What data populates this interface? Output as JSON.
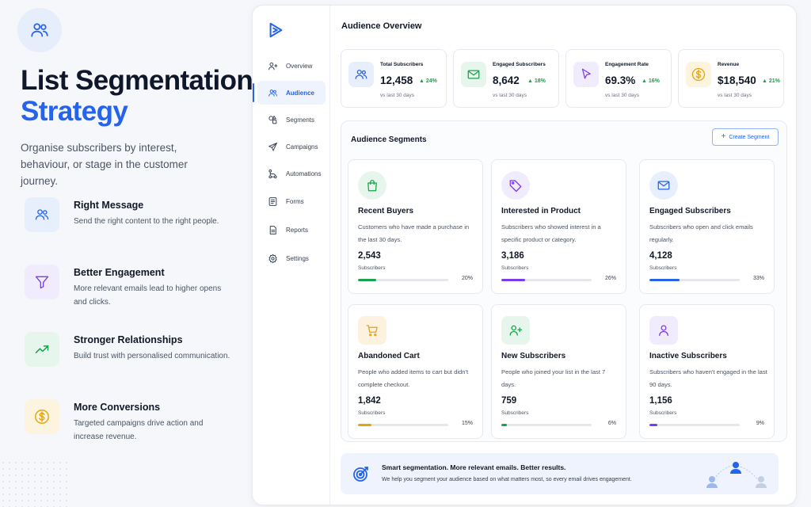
{
  "hero": {
    "title_line1": "List Segmentation",
    "title_line2": "Strategy",
    "subtitle": "Organise subscribers by interest, behaviour, or stage in the customer journey.",
    "features": [
      {
        "icon": "users-icon",
        "title": "Right Message",
        "desc": "Send the right content to the right people.",
        "color": "#2563eb",
        "bg": "#e8effc"
      },
      {
        "icon": "filter-icon",
        "title": "Better Engagement",
        "desc": "More relevant emails lead to higher opens and clicks.",
        "color": "#7c3aed",
        "bg": "#f1ecfd"
      },
      {
        "icon": "trend-up-icon",
        "title": "Stronger Relationships",
        "desc": "Build trust with personalised communication.",
        "color": "#16a34a",
        "bg": "#e7f6ec"
      },
      {
        "icon": "dollar-icon",
        "title": "More Conversions",
        "desc": "Targeted campaigns drive action and increase revenue.",
        "color": "#e5a50a",
        "bg": "#fdf4e0"
      }
    ]
  },
  "sidebar": {
    "items": [
      {
        "label": "Overview",
        "icon": "user-plus-icon",
        "active": false
      },
      {
        "label": "Audience",
        "icon": "users-icon",
        "active": true
      },
      {
        "label": "Segments",
        "icon": "shapes-icon",
        "active": false
      },
      {
        "label": "Campaigns",
        "icon": "send-icon",
        "active": false
      },
      {
        "label": "Automations",
        "icon": "workflow-icon",
        "active": false
      },
      {
        "label": "Forms",
        "icon": "form-icon",
        "active": false
      },
      {
        "label": "Reports",
        "icon": "report-icon",
        "active": false
      },
      {
        "label": "Settings",
        "icon": "gear-icon",
        "active": false
      }
    ]
  },
  "main": {
    "title": "Audience Overview",
    "stats": [
      {
        "label": "Total Subscribers",
        "value": "12,458",
        "change": "24%",
        "period": "vs last 30 days",
        "icon": "users-icon",
        "color": "#2563eb",
        "bg": "#e8effc"
      },
      {
        "label": "Engaged Subscribers",
        "value": "8,642",
        "change": "18%",
        "period": "vs last 30 days",
        "icon": "mail-icon",
        "color": "#16a34a",
        "bg": "#e7f6ec"
      },
      {
        "label": "Engagement Rate",
        "value": "69.3%",
        "change": "16%",
        "period": "vs last 30 days",
        "icon": "cursor-icon",
        "color": "#7c3aed",
        "bg": "#f1ecfd"
      },
      {
        "label": "Revenue",
        "value": "$18,540",
        "change": "21%",
        "period": "vs last 30 days",
        "icon": "dollar-icon",
        "color": "#e5a50a",
        "bg": "#fdf4e0"
      }
    ],
    "segments_title": "Audience Segments",
    "create_label": "Create Segment",
    "segments": [
      {
        "title": "Recent Buyers",
        "desc": "Customers who have made a purchase in the last 30 days.",
        "count": "2,543",
        "unit": "Subscribers",
        "pct": "20%",
        "fill": 0.2,
        "icon": "shopping-bag-icon",
        "color": "#16a34a",
        "bg": "#e7f6ec"
      },
      {
        "title": "Interested in Product",
        "desc": "Subscribers who showed interest in a specific product or category.",
        "count": "3,186",
        "unit": "Subscribers",
        "pct": "26%",
        "fill": 0.26,
        "icon": "tag-icon",
        "color": "#7c3aed",
        "bg": "#f1ecfd"
      },
      {
        "title": "Engaged Subscribers",
        "desc": "Subscribers who open and click emails regularly.",
        "count": "4,128",
        "unit": "Subscribers",
        "pct": "33%",
        "fill": 0.33,
        "icon": "mail-icon",
        "color": "#2563eb",
        "bg": "#e8effc"
      },
      {
        "title": "Abandoned Cart",
        "desc": "People who added items to cart but didn't complete checkout.",
        "count": "1,842",
        "unit": "Subscribers",
        "pct": "15%",
        "fill": 0.15,
        "icon": "cart-icon",
        "color": "#e5a50a",
        "bg": "#fdf1df"
      },
      {
        "title": "New Subscribers",
        "desc": "People who joined your list in the last 7 days.",
        "count": "759",
        "unit": "Subscribers",
        "pct": "6%",
        "fill": 0.06,
        "icon": "user-add-icon",
        "color": "#16a34a",
        "bg": "#e7f6ec"
      },
      {
        "title": "Inactive Subscribers",
        "desc": "Subscribers who haven't engaged in the last 90 days.",
        "count": "1,156",
        "unit": "Subscribers",
        "pct": "9%",
        "fill": 0.09,
        "icon": "user-icon",
        "color": "#7c3aed",
        "bg": "#f1ecfd"
      }
    ],
    "footer": {
      "title": "Smart segmentation. More relevant emails. Better results.",
      "desc": "We help you segment your audience based on what matters most, so every email drives engagement.",
      "icon": "target-icon"
    }
  },
  "colors": {
    "accent": "#2563eb",
    "positive": "#16a34a"
  }
}
